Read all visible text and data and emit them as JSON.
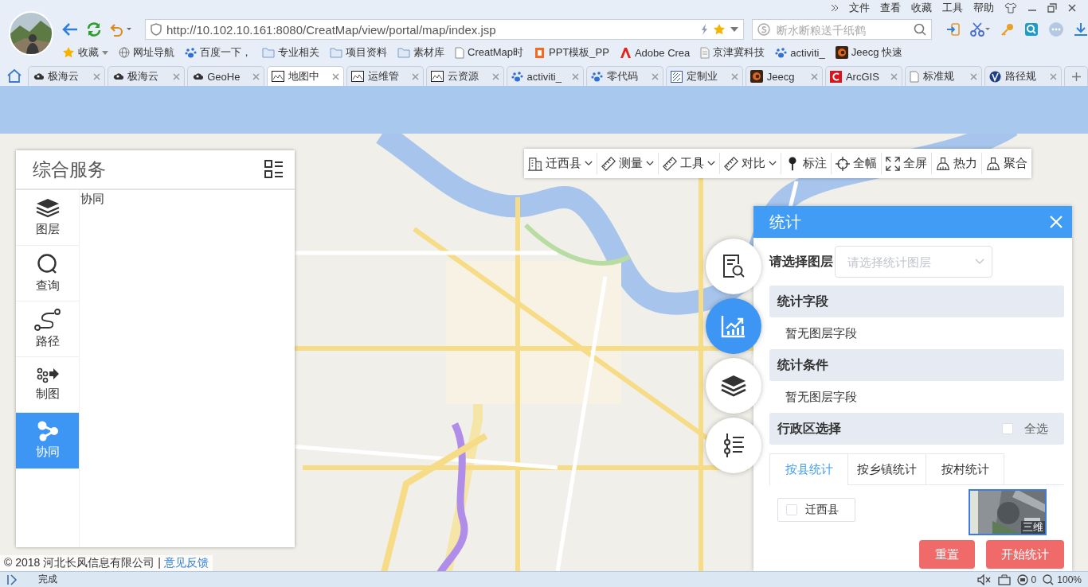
{
  "browser": {
    "menu": [
      "文件",
      "查看",
      "收藏",
      "工具",
      "帮助"
    ],
    "address": "http://10.102.10.161:8080/CreatMap/view/portal/map/index.jsp",
    "search": {
      "placeholder": "断水断粮送千纸鹤"
    },
    "bookmarks": [
      {
        "label": "收藏"
      },
      {
        "label": "网址导航"
      },
      {
        "label": "百度一下，"
      },
      {
        "label": "专业相关"
      },
      {
        "label": "项目资料"
      },
      {
        "label": "素材库"
      },
      {
        "label": "CreatMap时"
      },
      {
        "label": "PPT模板_PP"
      },
      {
        "label": "Adobe Crea"
      },
      {
        "label": "京津冀科技"
      },
      {
        "label": "activiti_"
      },
      {
        "label": "Jeecg 快速"
      }
    ],
    "tabs": [
      {
        "label": "极海云",
        "selected": false
      },
      {
        "label": "极海云",
        "selected": false
      },
      {
        "label": "GeoHe",
        "selected": false
      },
      {
        "label": "地图中",
        "selected": true
      },
      {
        "label": "运维管",
        "selected": false
      },
      {
        "label": "云资源",
        "selected": false
      },
      {
        "label": "activiti_",
        "selected": false
      },
      {
        "label": "零代码",
        "selected": false
      },
      {
        "label": "定制业",
        "selected": false
      },
      {
        "label": "Jeecg",
        "selected": false
      },
      {
        "label": "ArcGIS",
        "selected": false
      },
      {
        "label": "标准规",
        "selected": false
      },
      {
        "label": "路径规",
        "selected": false
      }
    ]
  },
  "toolbar": [
    {
      "label": "迁西县",
      "kind": "dropdown"
    },
    {
      "label": "测量",
      "kind": "dropdown"
    },
    {
      "label": "工具",
      "kind": "dropdown"
    },
    {
      "label": "对比",
      "kind": "dropdown"
    },
    {
      "label": "标注",
      "kind": "button"
    },
    {
      "label": "全幅",
      "kind": "button"
    },
    {
      "label": "全屏",
      "kind": "button"
    },
    {
      "label": "热力",
      "kind": "button"
    },
    {
      "label": "聚合",
      "kind": "button"
    }
  ],
  "side_panel": {
    "title": "综合服务",
    "content": "协同",
    "nav": [
      {
        "label": "图层",
        "selected": false
      },
      {
        "label": "查询",
        "selected": false
      },
      {
        "label": "路径",
        "selected": false
      },
      {
        "label": "制图",
        "selected": false
      },
      {
        "label": "协同",
        "selected": true
      }
    ]
  },
  "side_buttons": [
    {
      "selected": false
    },
    {
      "selected": true
    },
    {
      "selected": false
    },
    {
      "selected": false
    }
  ],
  "stats_panel": {
    "title": "统计",
    "layer_label": "请选择图层",
    "layer_select": {
      "placeholder": "请选择统计图层"
    },
    "sections": [
      {
        "heading": "统计字段",
        "text": "暂无图层字段"
      },
      {
        "heading": "统计条件",
        "text": "暂无图层字段"
      }
    ],
    "region": {
      "heading": "行政区选择",
      "select_all": {
        "label": "全选",
        "checked": false
      },
      "tabs": [
        {
          "label": "按县统计",
          "selected": true
        },
        {
          "label": "按乡镇统计",
          "selected": false
        },
        {
          "label": "按村统计",
          "selected": false
        }
      ],
      "options": [
        {
          "label": "迁西县",
          "checked": false
        }
      ]
    },
    "buttons": [
      "重置",
      "开始统计"
    ]
  },
  "map": {
    "mode_label": "三维",
    "copyright": "© 2018 河北长风信息有限公司 |",
    "feedback": "意见反馈"
  },
  "status_bar": {
    "status": "完成",
    "shield_count": "0",
    "zoom": "100%"
  }
}
